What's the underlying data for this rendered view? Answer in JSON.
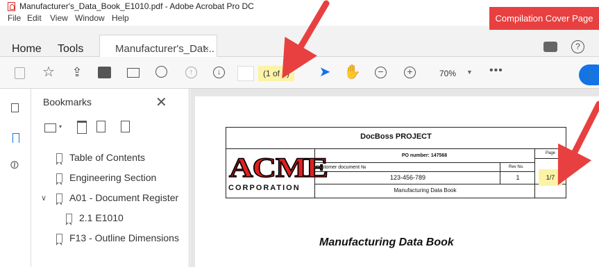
{
  "window": {
    "title": "Manufacturer's_Data_Book_E1010.pdf - Adobe Acrobat Pro DC"
  },
  "menu": [
    "File",
    "Edit",
    "View",
    "Window",
    "Help"
  ],
  "tabs": {
    "home": "Home",
    "tools": "Tools",
    "document": "Manufacturer's_Dat...",
    "close": "×"
  },
  "toolbar": {
    "page_indicator": "(1 of 7)",
    "zoom": "70%",
    "more": "•••",
    "icons": [
      "save-icon",
      "bookmark-star-icon",
      "cloud-upload-icon",
      "print-icon",
      "email-icon",
      "search-zoom-icon",
      "previous-page-icon",
      "next-page-icon",
      "select-cursor-icon",
      "hand-tool-icon",
      "zoom-out-icon",
      "zoom-in-icon",
      "add-user-icon"
    ]
  },
  "bookmarks": {
    "title": "Bookmarks",
    "close": "✕",
    "items": [
      {
        "label": "Table of Contents"
      },
      {
        "label": "Engineering Section"
      },
      {
        "label": "A01 - Document Register"
      },
      {
        "label": "2.1 E1010"
      },
      {
        "label": "F13 - Outline Dimensions"
      }
    ]
  },
  "document": {
    "header_title": "DocBoss PROJECT",
    "logo_text": "ACME",
    "logo_subtext": "CORPORATION",
    "po_number": "PO number: 147568",
    "customer_doc_label": "Customer document №",
    "rev_label": "Rev No.",
    "page_label": "Page",
    "customer_doc_number": "123-456-789",
    "rev_value": "1",
    "page_value": "1/7",
    "doc_title_cell": "Manufacturing Data Book",
    "heading": "Manufacturing Data Book"
  },
  "annotation": {
    "badge": "Compilation Cover Page",
    "color": "#e84040"
  },
  "colors": {
    "highlight": "#fbf3a6",
    "accent_blue": "#1473e6"
  }
}
